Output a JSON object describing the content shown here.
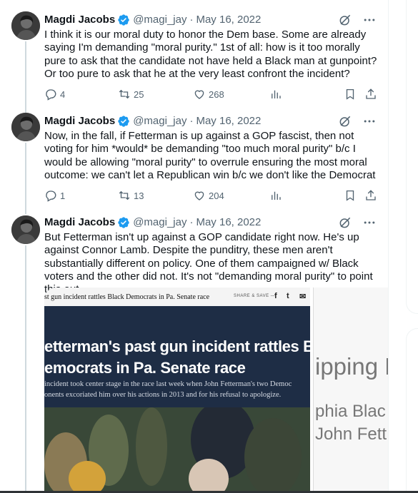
{
  "tweets": [
    {
      "name": "Magdi Jacobs",
      "handle": "@magi_jay",
      "date": "May 16, 2022",
      "text": "I think it is our moral duty to honor the Dem base. Some are already saying I'm demanding \"moral purity.\" 1st of all: how is it too morally pure to ask that the candidate not have held a Black man at gunpoint? Or too pure to ask that he at the very least confront the incident?",
      "replies": "4",
      "retweets": "25",
      "likes": "268"
    },
    {
      "name": "Magdi Jacobs",
      "handle": "@magi_jay",
      "date": "May 16, 2022",
      "text": "Now, in the fall, if Fetterman is up against a GOP fascist, then not voting for him *would* be demanding \"too much moral purity\" b/c I would be allowing \"moral purity\" to overrule ensuring the most moral outcome: we can't let a Republican win b/c we don't like the Democrat",
      "replies": "1",
      "retweets": "13",
      "likes": "204"
    },
    {
      "name": "Magdi Jacobs",
      "handle": "@magi_jay",
      "date": "May 16, 2022",
      "text": "But Fetterman isn't up against a GOP candidate right now. He's up against Connor Lamb. Despite the punditry, these men aren't substantially different on policy. One of them campaigned w/ Black voters and the other did not. It's not \"demanding moral purity\" to point this out."
    }
  ],
  "separator": "·",
  "media": {
    "kicker": "st gun incident rattles Black Democrats in Pa. Senate race",
    "share": "SHARE & SAVE —",
    "share_icons": [
      "f",
      "t",
      "✉"
    ],
    "headline_line1": "etterman's past gun incident rattles Bla",
    "headline_line2": "emocrats in Pa. Senate race",
    "sub_line1": "incident took center stage in the race last week when John Fetterman's two Democ",
    "sub_line2": "onents excoriated him over his actions in 2013 and for his refusal to apologize.",
    "right_big": "ipping B",
    "right_line1": "phia Blac",
    "right_line2": "John Fett"
  },
  "colors": {
    "verified": "#1d9bf0",
    "muted": "#536471",
    "thread_line": "#cfd9de"
  },
  "icons": [
    "verified-badge-icon",
    "grok-icon",
    "more-icon",
    "reply-icon",
    "retweet-icon",
    "like-icon",
    "views-icon",
    "bookmark-icon",
    "share-icon"
  ]
}
